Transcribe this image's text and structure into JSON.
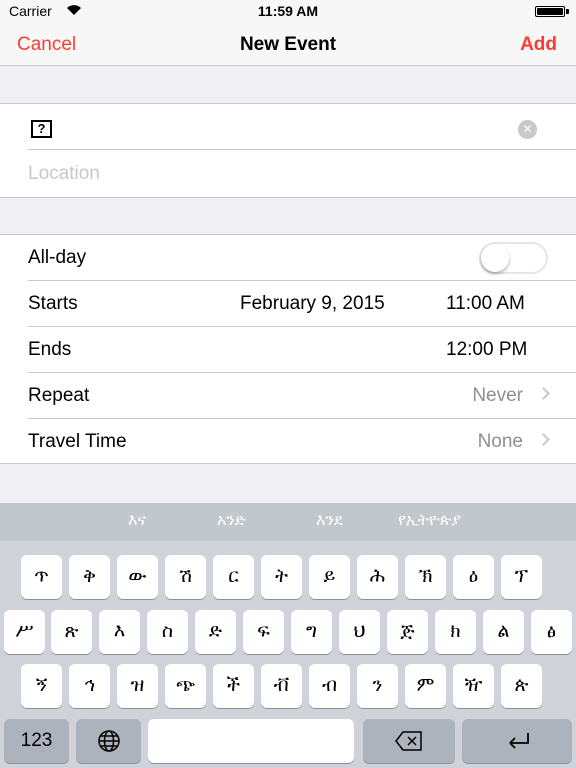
{
  "status_bar": {
    "carrier": "Carrier",
    "time": "11:59 AM"
  },
  "nav": {
    "cancel": "Cancel",
    "title": "New Event",
    "add": "Add"
  },
  "form": {
    "title_value": "?",
    "location_placeholder": "Location",
    "all_day_label": "All-day",
    "all_day_on": false,
    "starts_label": "Starts",
    "starts_date": "February 9, 2015",
    "starts_time": "11:00 AM",
    "ends_label": "Ends",
    "ends_time": "12:00 PM",
    "repeat_label": "Repeat",
    "repeat_value": "Never",
    "travel_label": "Travel Time",
    "travel_value": "None"
  },
  "keyboard": {
    "suggestions": [
      "እና",
      "አንድ",
      "እንደ",
      "የኢትዮጵያ"
    ],
    "row1": [
      "ጥ",
      "ቅ",
      "ው",
      "ሽ",
      "ር",
      "ት",
      "ይ",
      "ሕ",
      "ኽ",
      "ዕ",
      "ፕ"
    ],
    "row2": [
      "ሥ",
      "ጽ",
      "እ",
      "ስ",
      "ድ",
      "ፍ",
      "ግ",
      "ህ",
      "ጅ",
      "ክ",
      "ል",
      "ፅ"
    ],
    "row3": [
      "ኝ",
      "ኅ",
      "ዝ",
      "ጭ",
      "ች",
      "ቭ",
      "ብ",
      "ን",
      "ም",
      "ዥ",
      "ጵ"
    ],
    "numbers_key": "123"
  },
  "colors": {
    "accent": "#ff3b30",
    "separator": "#c8c7cc",
    "keyboard_bg": "#cfd3d9"
  }
}
